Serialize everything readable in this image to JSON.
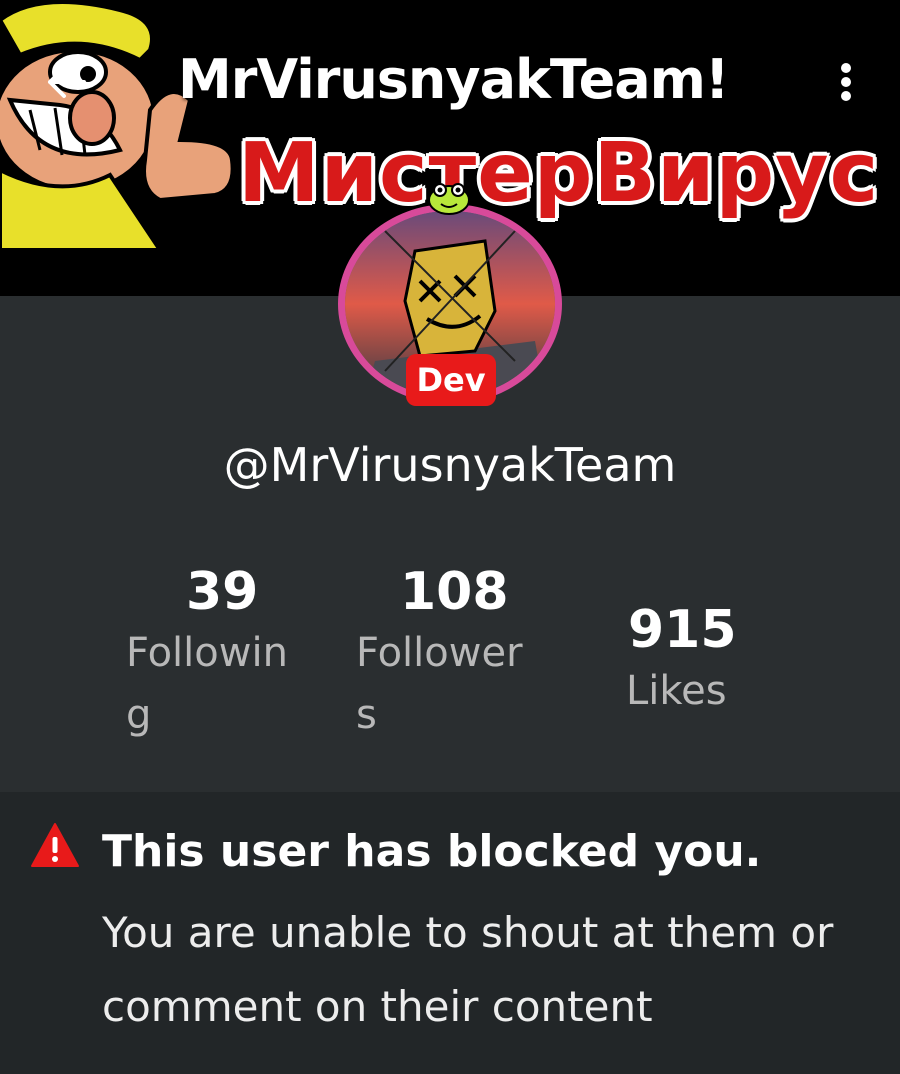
{
  "header": {
    "title": "MrVirusnyakTeam!",
    "banner_text": "МистерВирус"
  },
  "profile": {
    "username": "@MrVirusnyakTeam",
    "badge": "Dev"
  },
  "stats": {
    "following": {
      "value": "39",
      "label_line1": "Followin",
      "label_line2": "g"
    },
    "followers": {
      "value": "108",
      "label_line1": "Follower",
      "label_line2": "s"
    },
    "likes": {
      "value": "915",
      "label": "Likes"
    }
  },
  "notice": {
    "title": "This user has blocked you.",
    "body": "You are unable to shout at them or comment on their content"
  },
  "colors": {
    "background": "#2a2e30",
    "notice_background": "#222628",
    "badge": "#e81a1a",
    "avatar_ring": "#d84a9a",
    "warning": "#e81a1a"
  },
  "icons": {
    "back": "back-arrow-icon",
    "menu": "more-vertical-icon",
    "warning": "warning-triangle-icon"
  }
}
